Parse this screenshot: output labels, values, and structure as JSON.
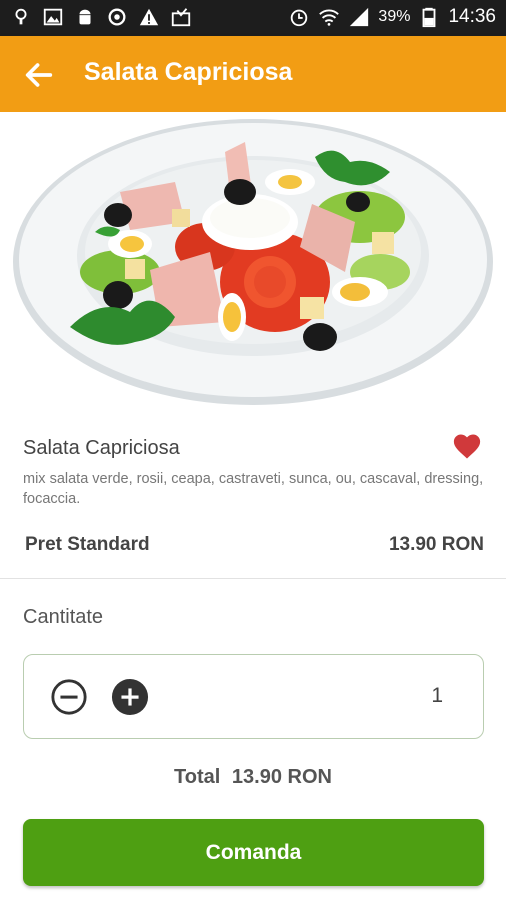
{
  "status_bar": {
    "icons_left": [
      "location-pin-icon",
      "image-icon",
      "android-icon",
      "sync-icon",
      "warning-icon",
      "inbox-icon"
    ],
    "icons_right": [
      "alarm-icon",
      "wifi-icon",
      "signal-icon",
      "battery-icon"
    ],
    "battery": "39%",
    "time": "14:36"
  },
  "app_bar": {
    "title": "Salata Capriciosa",
    "background": "#f29d14"
  },
  "product": {
    "name": "Salata Capriciosa",
    "description": "mix salata verde, rosii, ceapa, castraveti, sunca, ou, cascaval, dressing, focaccia.",
    "favorite": true,
    "favorite_color": "#d0393b",
    "price_label": "Pret Standard",
    "price_value": "13.90 RON"
  },
  "quantity": {
    "label": "Cantitate",
    "value": "1"
  },
  "total": {
    "label": "Total",
    "value": "13.90 RON"
  },
  "order_button": {
    "label": "Comanda",
    "color": "#4e9f12"
  }
}
